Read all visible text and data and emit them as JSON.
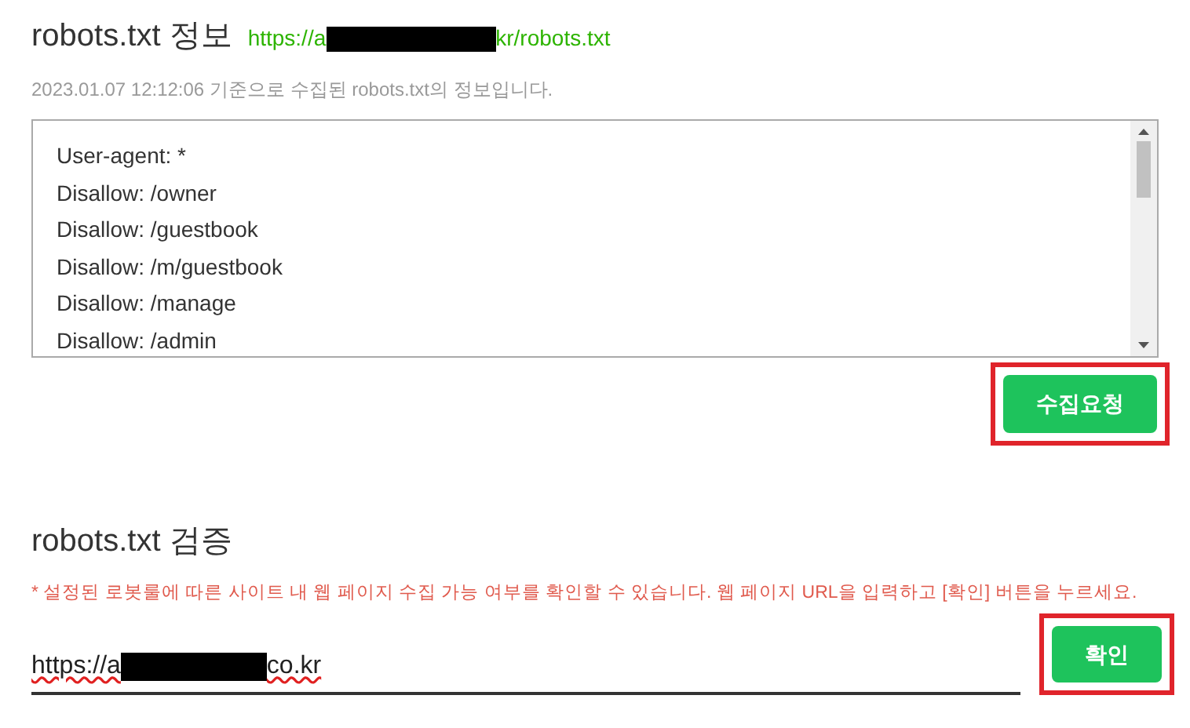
{
  "info": {
    "title": "robots.txt 정보",
    "url_start": "https://a",
    "url_end": "kr/robots.txt",
    "subtitle": "2023.01.07 12:12:06 기준으로 수집된 robots.txt의 정보입니다.",
    "lines": [
      "User-agent: *",
      "Disallow: /owner",
      "Disallow: /guestbook",
      "Disallow: /m/guestbook",
      "Disallow: /manage",
      "Disallow: /admin"
    ],
    "button": "수집요청"
  },
  "verify": {
    "title": "robots.txt 검증",
    "note": "* 설정된 로봇룰에 따른 사이트 내 웹 페이지 수집 가능 여부를 확인할 수 있습니다. 웹 페이지 URL을 입력하고 [확인] 버튼을 누르세요.",
    "value_start": "https://a",
    "value_end": "co.kr",
    "button": "확인"
  }
}
